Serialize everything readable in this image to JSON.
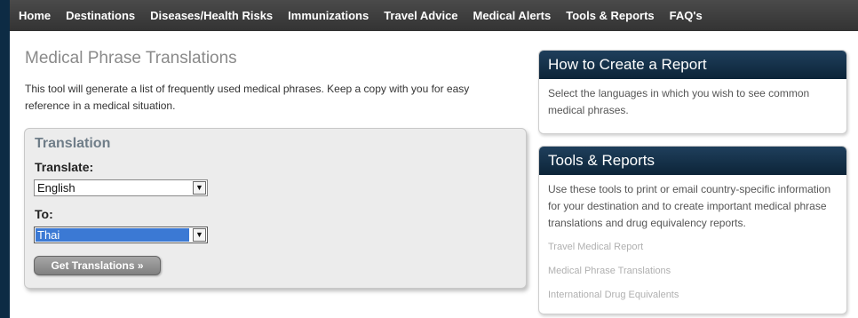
{
  "nav": {
    "items": [
      "Home",
      "Destinations",
      "Diseases/Health Risks",
      "Immunizations",
      "Travel Advice",
      "Medical Alerts",
      "Tools & Reports",
      "FAQ's"
    ]
  },
  "main": {
    "title": "Medical Phrase Translations",
    "intro_line1": "This tool will generate a list of frequently used medical phrases. Keep a copy with you for easy",
    "intro_line2": "reference in a medical situation.",
    "translation": {
      "title": "Translation",
      "translate_label": "Translate:",
      "translate_value": "English",
      "to_label": "To:",
      "to_value": "Thai",
      "button_label": "Get Translations »"
    }
  },
  "sidebar": {
    "how_to": {
      "title": "How to Create a Report",
      "text": "Select the languages in which you wish to see common medical phrases."
    },
    "tools": {
      "title": "Tools & Reports",
      "text": "Use these tools to print or email country-specific information for your destination and to create important medical phrase translations and drug equivalency reports.",
      "links": [
        "Travel Medical Report",
        "Medical Phrase Translations",
        "International Drug Equivalents"
      ]
    }
  },
  "colors": {
    "nav_bg": "#3c3c3c",
    "card_header": "#163650",
    "selection": "#3b79d4"
  },
  "icons": {
    "select_arrow": "chevron-down-icon"
  }
}
